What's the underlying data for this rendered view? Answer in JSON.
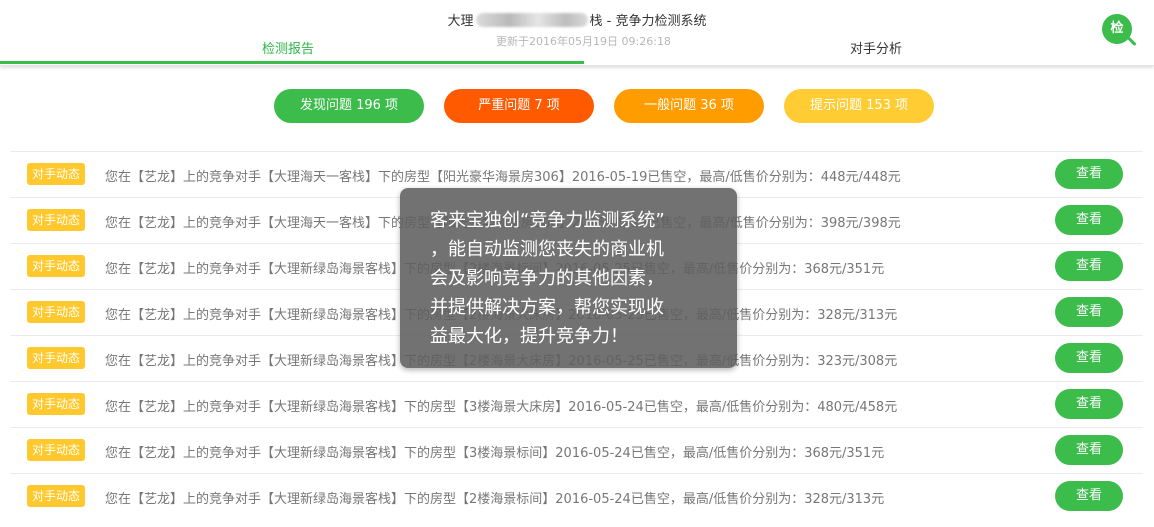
{
  "header": {
    "title_prefix": "大理",
    "title_suffix": "栈 - 竞争力检测系统",
    "updated": "更新于2016年05月19日 09:26:18",
    "tabs": [
      {
        "label": "检测报告",
        "active": true
      },
      {
        "label": "对手分析",
        "active": false
      }
    ],
    "search_label": "检"
  },
  "summary": [
    {
      "label": "发现问题 196 项",
      "color": "#3cbc4b"
    },
    {
      "label": "严重问题 7 项",
      "color": "#ff5a00"
    },
    {
      "label": "一般问题 36 项",
      "color": "#ff9c00"
    },
    {
      "label": "提示问题 153 项",
      "color": "#ffcc33"
    }
  ],
  "rows": [
    {
      "tag": "对手动态",
      "text": "您在【艺龙】上的竞争对手【大理海天一客栈】下的房型【阳光豪华海景房306】2016-05-19已售空，最高/低售价分别为：448元/448元",
      "button": "查看"
    },
    {
      "tag": "对手动态",
      "text": "您在【艺龙】上的竞争对手【大理海天一客栈】下的房型【阳光豪华海景房306】2016-05-19已售空，最高/低售价分别为：398元/398元",
      "button": "查看"
    },
    {
      "tag": "对手动态",
      "text": "您在【艺龙】上的竞争对手【大理新绿岛海景客栈】下的房型【2楼海景标间】2016-05-25已售空，最高/低售价分别为：368元/351元",
      "button": "查看"
    },
    {
      "tag": "对手动态",
      "text": "您在【艺龙】上的竞争对手【大理新绿岛海景客栈】下的房型【2楼海景大床房】2016-05-25已售空，最高/低售价分别为：328元/313元",
      "button": "查看"
    },
    {
      "tag": "对手动态",
      "text": "您在【艺龙】上的竞争对手【大理新绿岛海景客栈】下的房型【2楼海景大床房】2016-05-25已售空，最高/低售价分别为：323元/308元",
      "button": "查看"
    },
    {
      "tag": "对手动态",
      "text": "您在【艺龙】上的竞争对手【大理新绿岛海景客栈】下的房型【3楼海景大床房】2016-05-24已售空，最高/低售价分别为：480元/458元",
      "button": "查看"
    },
    {
      "tag": "对手动态",
      "text": "您在【艺龙】上的竞争对手【大理新绿岛海景客栈】下的房型【3楼海景标间】2016-05-24已售空，最高/低售价分别为：368元/351元",
      "button": "查看"
    },
    {
      "tag": "对手动态",
      "text": "您在【艺龙】上的竞争对手【大理新绿岛海景客栈】下的房型【2楼海景标间】2016-05-24已售空，最高/低售价分别为：328元/313元",
      "button": "查看"
    }
  ],
  "tooltip": {
    "lines": [
      "客来宝独创“竞争力监测系统”",
      "，能自动监测您丧失的商业机",
      "会及影响竞争力的其他因素，",
      "并提供解决方案，帮您实现收",
      "益最大化，提升竞争力！"
    ]
  },
  "colors": {
    "accent_green": "#3cbc4b",
    "serious": "#ff5a00",
    "general": "#ff9c00",
    "hint": "#ffcc33",
    "tag": "#ffc82c"
  }
}
